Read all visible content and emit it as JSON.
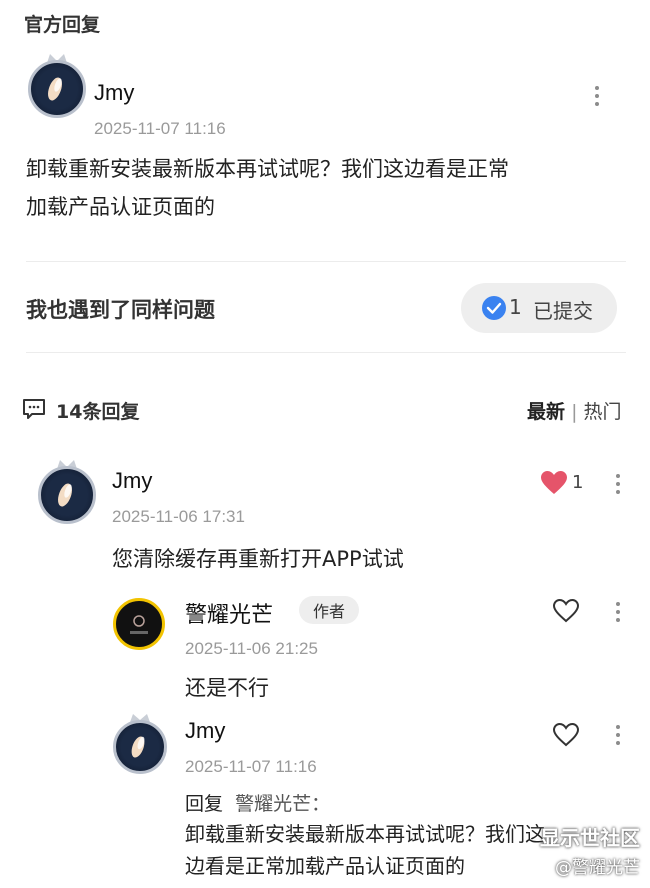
{
  "official_reply": {
    "section_title": "官方回复",
    "author": "Jmy",
    "timestamp": "2025-11-07 11:16",
    "text_line1": "卸载重新安装最新版本再试试呢？我们这边看是正常",
    "text_line2": "加载产品认证页面的"
  },
  "same_issue": {
    "label": "我也遇到了同样问题",
    "count": "1",
    "status": "已提交"
  },
  "replies_header": {
    "count_label": "14条回复",
    "sort_latest": "最新",
    "sort_separator": "|",
    "sort_hot": "热门"
  },
  "comments": [
    {
      "author": "Jmy",
      "timestamp": "2025-11-06 17:31",
      "text": "您清除缓存再重新打开APP试试",
      "likes": "1",
      "liked": true
    }
  ],
  "sub_replies": [
    {
      "author": "警耀光芒",
      "badge": "作者",
      "timestamp": "2025-11-06 21:25",
      "text": "还是不行"
    },
    {
      "author": "Jmy",
      "timestamp": "2025-11-07 11:16",
      "reply_prefix": "回复",
      "reply_to": "警耀光芒：",
      "text_line1": "卸载重新安装最新版本再试试呢？我们这",
      "text_line2": "边看是正常加载产品认证页面的"
    }
  ],
  "watermark": {
    "line1": "显示世社区",
    "line2": "@警耀光芒"
  },
  "colors": {
    "heart_active": "#e5546a",
    "check_blue": "#3a82f0"
  }
}
